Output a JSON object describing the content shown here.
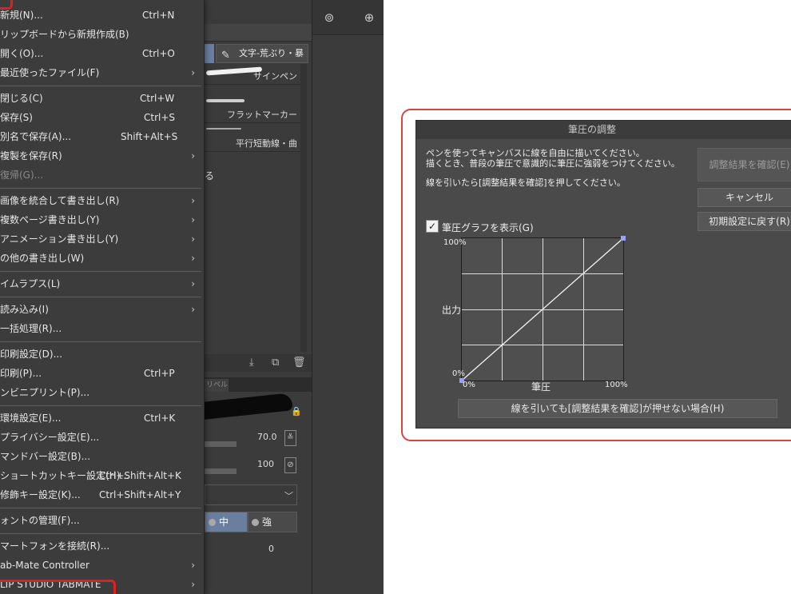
{
  "file_menu": {
    "items": [
      {
        "label": "新規(N)...",
        "shortcut": "Ctrl+N",
        "arrow": ""
      },
      {
        "label": "リップボードから新規作成(B)",
        "shortcut": "",
        "arrow": ""
      },
      {
        "label": "開く(O)...",
        "shortcut": "Ctrl+O",
        "arrow": ""
      },
      {
        "label": "最近使ったファイル(F)",
        "shortcut": "",
        "arrow": "›"
      },
      {
        "label": "閉じる(C)",
        "shortcut": "Ctrl+W",
        "arrow": ""
      },
      {
        "label": "保存(S)",
        "shortcut": "Ctrl+S",
        "arrow": ""
      },
      {
        "label": "別名で保存(A)...",
        "shortcut": "Shift+Alt+S",
        "arrow": ""
      },
      {
        "label": "複製を保存(R)",
        "shortcut": "",
        "arrow": "›"
      },
      {
        "label": "復帰(G)...",
        "shortcut": "",
        "arrow": ""
      },
      {
        "label": "画像を統合して書き出し(R)",
        "shortcut": "",
        "arrow": "›"
      },
      {
        "label": "複数ページ書き出し(Y)",
        "shortcut": "",
        "arrow": "›"
      },
      {
        "label": "アニメーション書き出し(Y)",
        "shortcut": "",
        "arrow": "›"
      },
      {
        "label": "の他の書き出し(W)",
        "shortcut": "",
        "arrow": "›"
      },
      {
        "label": "イムラプス(L)",
        "shortcut": "",
        "arrow": "›"
      },
      {
        "label": "読み込み(I)",
        "shortcut": "",
        "arrow": "›"
      },
      {
        "label": "一括処理(R)...",
        "shortcut": "",
        "arrow": ""
      },
      {
        "label": "印刷設定(D)...",
        "shortcut": "",
        "arrow": ""
      },
      {
        "label": "印刷(P)...",
        "shortcut": "Ctrl+P",
        "arrow": ""
      },
      {
        "label": "ンビニプリント(P)...",
        "shortcut": "",
        "arrow": ""
      },
      {
        "label": "環境設定(E)...",
        "shortcut": "Ctrl+K",
        "arrow": ""
      },
      {
        "label": "プライバシー設定(E)...",
        "shortcut": "",
        "arrow": ""
      },
      {
        "label": "マンドバー設定(B)...",
        "shortcut": "",
        "arrow": ""
      },
      {
        "label": "ショートカットキー設定(H)...",
        "shortcut": "Ctrl+Shift+Alt+K",
        "arrow": ""
      },
      {
        "label": "修飾キー設定(K)...",
        "shortcut": "Ctrl+Shift+Alt+Y",
        "arrow": ""
      },
      {
        "label": "ォントの管理(F)...",
        "shortcut": "",
        "arrow": ""
      },
      {
        "label": "マートフォンを接続(R)...",
        "shortcut": "",
        "arrow": ""
      },
      {
        "label": "ab-Mate Controller",
        "shortcut": "",
        "arrow": "›"
      },
      {
        "label": "LIP STUDIO TABMATE",
        "shortcut": "",
        "arrow": "›"
      }
    ]
  },
  "brush_panel": {
    "tab_label": "文字-荒ぶり・暴",
    "brushes": [
      "サインペン",
      "フラットマーカー",
      "平行短動線・曲"
    ],
    "fragment": "る",
    "subtab_label": "リペル",
    "size_value": "70.0",
    "opacity_value": "100",
    "seg_mid": "中",
    "seg_strong": "強",
    "other_value": "0"
  },
  "dialog": {
    "title": "筆圧の調整",
    "instruction_1": "ペンを使ってキャンバスに線を自由に描いてください。",
    "instruction_2": "描くとき、普段の筆圧で意識的に筆圧に強弱をつけてください。",
    "instruction_3": "線を引いたら[調整結果を確認]を押してください。",
    "confirm_button": "調整結果を確認(E)",
    "cancel_button": "キャンセル",
    "reset_button": "初期設定に戻す(R)",
    "show_graph_label": "筆圧グラフを表示(G)",
    "show_graph_checked": true,
    "graph": {
      "y_top": "100%",
      "y_mid": "出力",
      "y_bottom": "0%",
      "x_left": "0%",
      "x_mid": "筆圧",
      "x_right": "100%",
      "curve": [
        [
          0,
          0
        ],
        [
          100,
          100
        ]
      ]
    },
    "help_button": "線を引いても[調整結果を確認]が押せない場合(H)"
  }
}
